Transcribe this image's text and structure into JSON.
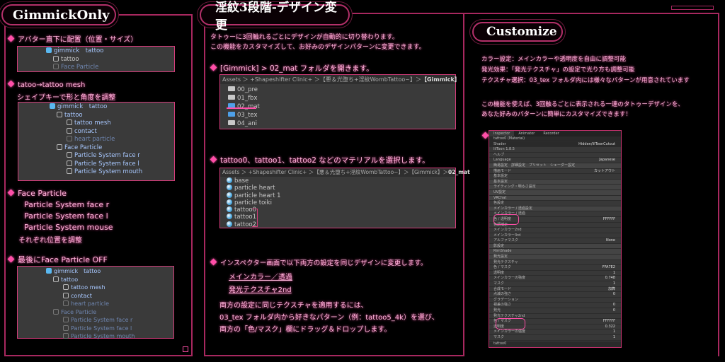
{
  "header": {
    "left_title": "GimmickOnly",
    "center_title": "淫紋3段階-デザイン変更",
    "right_title": "Customize"
  },
  "left": {
    "step1": "アバター直下に配置（位置・サイズ）",
    "tree1": [
      {
        "label": "gimmick　tattoo",
        "state": "root"
      },
      {
        "label": "tattoo",
        "state": "normal"
      },
      {
        "label": "Face Particle",
        "state": "dim"
      }
    ],
    "step2_line1": "tatoo→tattoo mesh",
    "step2_line2": "シェイプキーで形と角度を調整",
    "tree2": [
      {
        "label": "gimmick　tattoo",
        "state": "root"
      },
      {
        "label": "tattoo",
        "state": "blue"
      },
      {
        "label": "tattoo mesh",
        "state": "blue"
      },
      {
        "label": "contact",
        "state": "blue"
      },
      {
        "label": "heart particle",
        "state": "dim"
      },
      {
        "label": "Face Particle",
        "state": "blue"
      },
      {
        "label": "Particle System face r",
        "state": "blue"
      },
      {
        "label": "Particle System face l",
        "state": "blue"
      },
      {
        "label": "Particle System mouth",
        "state": "blue"
      }
    ],
    "step3_title": "Face Particle",
    "step3_items": [
      "Particle System face r",
      "Particle System face l",
      "Particle System mouse"
    ],
    "step3_note": "それぞれ位置を調整",
    "step4": "最後にFace Particle OFF",
    "tree3": [
      {
        "label": "gimmick　tattoo",
        "state": "root"
      },
      {
        "label": "tattoo",
        "state": "blue"
      },
      {
        "label": "tattoo mesh",
        "state": "blue"
      },
      {
        "label": "contact",
        "state": "blue"
      },
      {
        "label": "heart particle",
        "state": "dim"
      },
      {
        "label": "Face Particle",
        "state": "dim"
      },
      {
        "label": "Particle System face r",
        "state": "dim"
      },
      {
        "label": "Particle System face l",
        "state": "dim"
      },
      {
        "label": "Particle System mouth",
        "state": "dim"
      }
    ]
  },
  "center": {
    "intro1": "タトゥーに3回触れるごとにデザインが自動的に切り替わります。",
    "intro2": "この機能をカスタマイズして、お好みのデザインパターンに変更できます。",
    "step1": "[Gimmick] > 02_mat フォルダを開きます。",
    "path1": "Assets ＞ +Shapeshifter Clinic+ ＞【悪＆光堕ち+淫紋WombTattoo~】＞",
    "path1_bold": "【Gimmick】",
    "folders": [
      "00_pre",
      "01_fbx",
      "02_mat",
      "03_tex",
      "04_ani"
    ],
    "step2": "tattoo0、tattoo1、tattoo2 などのマテリアルを選択します。",
    "path2": "Assets ＞ +Shapeshifter Clinic+ ＞【悪＆光堕ち+淫紋WombTattoo~】＞【Gimmick】＞",
    "path2_bold": "02_mat",
    "materials": [
      "base",
      "particle heart",
      "particle heart 1",
      "particle toiki",
      "tattoo0",
      "tattoo1",
      "tattoo2"
    ],
    "step3": "インスペクター画面で以下両方の設定を同じデザインに変更します。",
    "link1": "メインカラー／透過",
    "link2": "発光テクスチャ2nd",
    "note1": "両方の設定に同じテクスチャを適用するには、",
    "note2": "03_tex フォルダ内から好きなパターン（例：tattoo5_4k）を選び、",
    "note3": "両方の「色/マスク」欄にドラッグ＆ドロップします。"
  },
  "right": {
    "line1": "カラー設定：メインカラーや透明度を自由に調整可能",
    "line2": "発光効果：「発光テクスチャ」の設定で光り方も調整可能",
    "line3": "テクスチャ選択：03_tex フォルダ内には様々なパターンが用意されています",
    "line4": "この機能を使えば、3回触るごとに表示される一連のタトゥーデザインを、",
    "line5": "あなた好みのパターンに簡単にカスタマイズできます！",
    "inspector": {
      "tabs": [
        "Inspector",
        "Animator",
        "Recorder"
      ],
      "material": "tattoo0 (Material)",
      "rows": [
        {
          "l": "Shader",
          "v": "Hidden/lilToonCutout",
          "c": "hd"
        },
        {
          "l": "lilToon 1.8.5",
          "v": ""
        },
        {
          "l": "ヘルプ",
          "v": ""
        },
        {
          "l": "Language",
          "v": "Japanese"
        },
        {
          "l": "簡易設定　詳細設定　プリセット　シェーダー設定",
          "v": "",
          "c": "sec"
        },
        {
          "l": "描画モード",
          "v": "カットアウト"
        },
        {
          "l": "基本設定",
          "v": ""
        },
        {
          "l": "基本設定",
          "v": "",
          "c": "sec"
        },
        {
          "l": "ライティング・明るさ設定",
          "v": "",
          "c": "sec"
        },
        {
          "l": "UV設定",
          "v": "",
          "c": "sec"
        },
        {
          "l": "VRChat",
          "v": "",
          "c": "sec"
        },
        {
          "l": "色設定",
          "v": ""
        },
        {
          "l": "メインカラー / 透過設定",
          "v": "",
          "c": "sec"
        },
        {
          "l": "メインカラー / 透過",
          "v": ""
        },
        {
          "l": "色 / 透明度",
          "v": "FFFFFF"
        },
        {
          "l": "色調補正",
          "v": ""
        },
        {
          "l": "メインカラー2nd",
          "v": ""
        },
        {
          "l": "メインカラー3rd",
          "v": ""
        },
        {
          "l": "アルファマスク",
          "v": "None"
        },
        {
          "l": "影設定",
          "v": "",
          "c": "sec"
        },
        {
          "l": "RimShade",
          "v": "",
          "c": "sec"
        },
        {
          "l": "発光設定",
          "v": "",
          "c": "sec"
        },
        {
          "l": "発光テクスチャ",
          "v": ""
        },
        {
          "l": "色 / マスク",
          "v": "FFA7E2"
        },
        {
          "l": "透明度",
          "v": "1"
        },
        {
          "l": "メインカラーの強度",
          "v": "0.748"
        },
        {
          "l": "マスク",
          "v": "1"
        },
        {
          "l": "合成モード",
          "v": "加算"
        },
        {
          "l": "点滅の強さ",
          "v": "0"
        },
        {
          "l": "グラデーション",
          "v": ""
        },
        {
          "l": "視差の強さ",
          "v": "0"
        },
        {
          "l": "発光",
          "v": "0"
        },
        {
          "l": "発光テクスチャ2nd",
          "v": ""
        },
        {
          "l": "色 / マスク",
          "v": "FFFFFF"
        },
        {
          "l": "透明度",
          "v": "0.322"
        },
        {
          "l": "メインカラーの強度",
          "v": "1"
        },
        {
          "l": "マスク",
          "v": "1"
        }
      ],
      "footer": "tattoo0"
    }
  }
}
